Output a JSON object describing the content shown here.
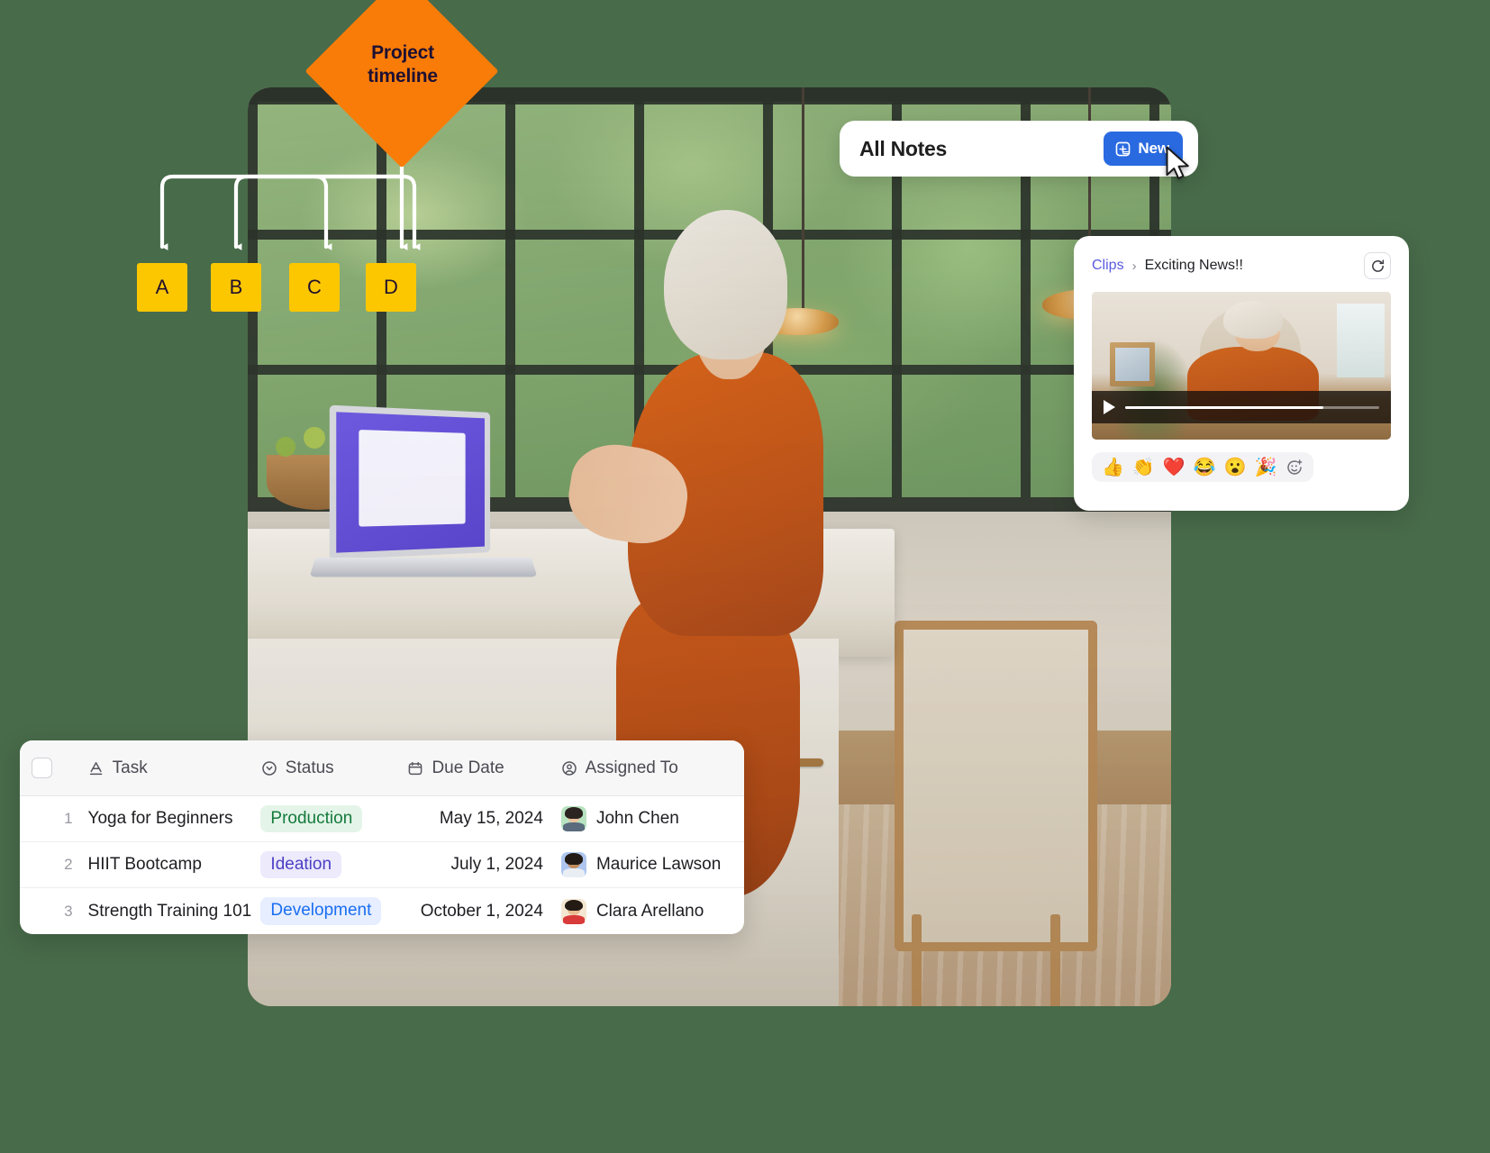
{
  "diagram": {
    "root_label": "Project\ntimeline",
    "root_label_line1": "Project",
    "root_label_line2": "timeline",
    "root_color": "#F97C08",
    "node_color": "#FDC700",
    "nodes": [
      {
        "label": "A"
      },
      {
        "label": "B"
      },
      {
        "label": "C"
      },
      {
        "label": "D"
      }
    ]
  },
  "notes_card": {
    "title": "All Notes",
    "new_button_label": "New",
    "new_button_color": "#2A6AE0",
    "new_button_icon": "note-add-icon",
    "cursor_icon": "mouse-pointer-icon"
  },
  "clips_card": {
    "breadcrumb_root": "Clips",
    "breadcrumb_separator": "›",
    "breadcrumb_current": "Exciting News!!",
    "breadcrumb_link_color": "#5B5BE0",
    "refresh_icon": "refresh-icon",
    "video": {
      "play_icon": "play-icon",
      "progress_percent": 78
    },
    "reactions": [
      {
        "name": "thumbs-up-emoji",
        "glyph": "👍"
      },
      {
        "name": "clap-emoji",
        "glyph": "👏"
      },
      {
        "name": "red-heart-emoji",
        "glyph": "❤️"
      },
      {
        "name": "joy-emoji",
        "glyph": "😂"
      },
      {
        "name": "open-mouth-emoji",
        "glyph": "😮"
      },
      {
        "name": "party-popper-emoji",
        "glyph": "🎉"
      }
    ],
    "add_reaction_icon": "add-reaction-icon"
  },
  "table_card": {
    "columns": [
      {
        "label": "Task",
        "icon": "text-field-icon"
      },
      {
        "label": "Status",
        "icon": "single-select-icon"
      },
      {
        "label": "Due Date",
        "icon": "calendar-icon"
      },
      {
        "label": "Assigned To",
        "icon": "user-circle-icon"
      }
    ],
    "select_all_icon": "checkbox-icon",
    "rows": [
      {
        "num": "1",
        "task": "Yoga for Beginners",
        "status": "Production",
        "status_style": "production",
        "due_date": "May 15, 2024",
        "assignee": "John Chen",
        "avatar_style": "green"
      },
      {
        "num": "2",
        "task": "HIIT Bootcamp",
        "status": "Ideation",
        "status_style": "ideation",
        "due_date": "July 1, 2024",
        "assignee": "Maurice Lawson",
        "avatar_style": "blue"
      },
      {
        "num": "3",
        "task": "Strength Training 101",
        "status": "Development",
        "status_style": "development",
        "due_date": "October 1, 2024",
        "assignee": "Clara Arellano",
        "avatar_style": "cream"
      }
    ]
  },
  "background": {
    "color": "#486B4A"
  }
}
